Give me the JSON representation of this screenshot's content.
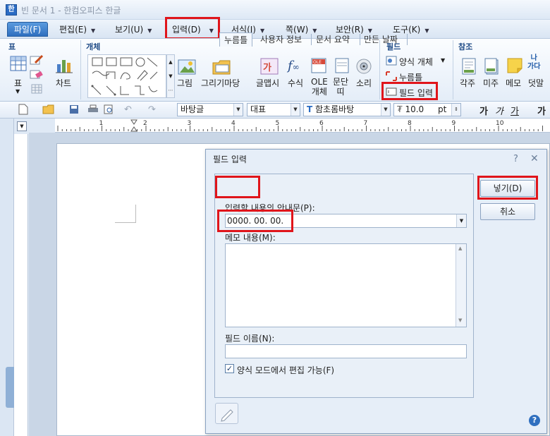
{
  "window": {
    "title": "빈 문서 1 - 한컴오피스 한글",
    "app_icon": "hwp-app-icon"
  },
  "menubar": {
    "items": [
      {
        "label": "파일(F)"
      },
      {
        "label": "편집(E)"
      },
      {
        "label": "보기(U)"
      },
      {
        "label": "입력(D)"
      },
      {
        "label": "서식(J)"
      },
      {
        "label": "쪽(W)"
      },
      {
        "label": "보안(R)"
      },
      {
        "label": "도구(K)"
      }
    ]
  },
  "ribbon": {
    "groups": {
      "table": "표",
      "object": "개체",
      "field": "필드",
      "reference": "참조"
    },
    "buttons": {
      "table": "표",
      "chart": "차트",
      "picture": "그림",
      "drawing_mart": "그리기마당",
      "glyph": "글맵시",
      "formula": "수식",
      "ole": "OLE\n개체",
      "paragraph": "문단\n띠",
      "sound": "소리",
      "form_object": "양식 개체",
      "click_here": "누름틀",
      "field_input": "필드 입력",
      "footnote": "각주",
      "endnote": "미주",
      "memo": "메모",
      "ruby": "덧말",
      "ruby_icon_text": "나\n가다"
    }
  },
  "toolbar": {
    "style": "바탕글",
    "language": "대표",
    "font": "함초롬바탕",
    "size": "10.0",
    "size_unit": "pt",
    "bold": "가",
    "italic": "가",
    "underline": "가",
    "more": "가"
  },
  "ruler": {
    "ticks": [
      "1",
      "2",
      "3",
      "4",
      "5",
      "6",
      "7",
      "8",
      "9",
      "10"
    ]
  },
  "dialog": {
    "title": "필드 입력",
    "help": "?",
    "close": "✕",
    "tabs": [
      "누름틀",
      "사용자 정보",
      "문서 요약",
      "만든 날짜"
    ],
    "guide_label": "입력할 내용의 안내문(P):",
    "guide_value": "0000. 00. 00.",
    "memo_label": "메모 내용(M):",
    "memo_value": "",
    "field_name_label": "필드 이름(N):",
    "field_name_value": "",
    "checkbox_label": "양식 모드에서 편집 가능(F)",
    "checkbox_checked": true,
    "insert_button": "넣기(D)",
    "cancel_button": "취소"
  }
}
